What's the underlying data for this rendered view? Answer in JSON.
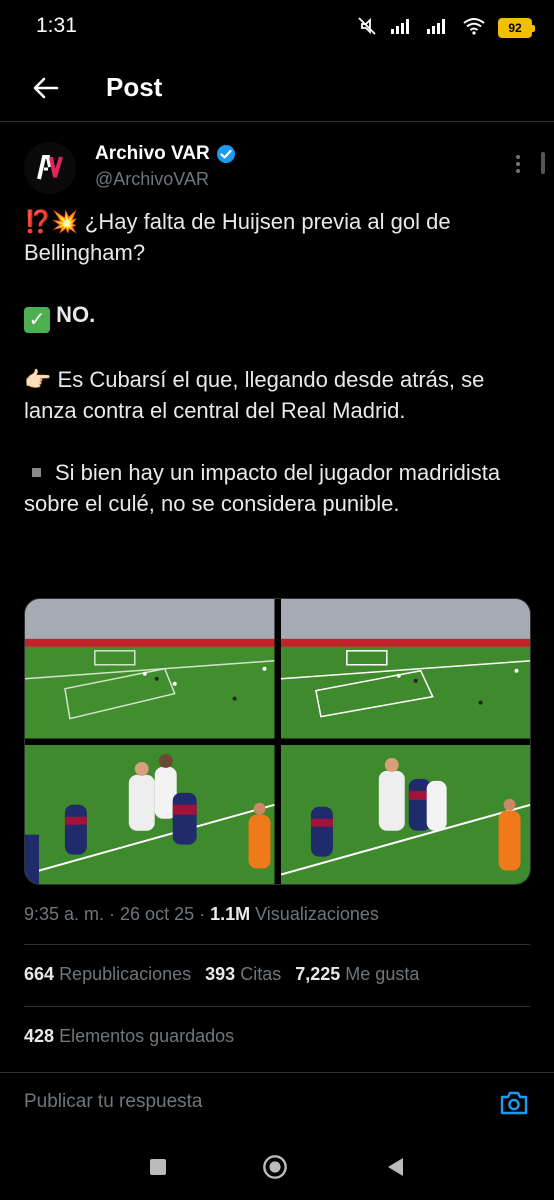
{
  "status": {
    "time": "1:31",
    "battery": "92"
  },
  "header": {
    "title": "Post"
  },
  "author": {
    "name": "Archivo VAR",
    "handle": "@ArchivoVAR",
    "avatar_text": "AV"
  },
  "tweet": {
    "line1_prefix": "⁉️💥",
    "line1": "¿Hay falta de Huijsen previa al gol de Bellingham?",
    "line2_emoji": "✓",
    "line2": "NO.",
    "line3_emoji": "👉🏻",
    "line3": "Es Cubarsí el que, llegando desde atrás, se lanza contra el central del Real Madrid.",
    "line4": "Si bien hay un impacto del jugador madridista sobre el culé, no se considera punible."
  },
  "meta": {
    "time": "9:35 a. m. · 26 oct 25 · ",
    "views_count": "1.1M",
    "views_label": " Visualizaciones"
  },
  "stats": {
    "reposts_count": "664",
    "reposts_label": "Republicaciones",
    "quotes_count": "393",
    "quotes_label": "Citas",
    "likes_count": "7,225",
    "likes_label": "Me gusta",
    "saved_count": "428",
    "saved_label": "Elementos guardados"
  },
  "reply": {
    "placeholder": "Publicar tu respuesta"
  },
  "colors": {
    "background": "#000000",
    "accent": "#1d9bf0",
    "muted": "#71767b",
    "pitch": "#3f8a2c"
  },
  "icons": [
    "back-arrow-icon",
    "verified-badge-icon",
    "more-icon",
    "camera-icon",
    "recents-icon",
    "home-icon",
    "back-nav-icon"
  ]
}
